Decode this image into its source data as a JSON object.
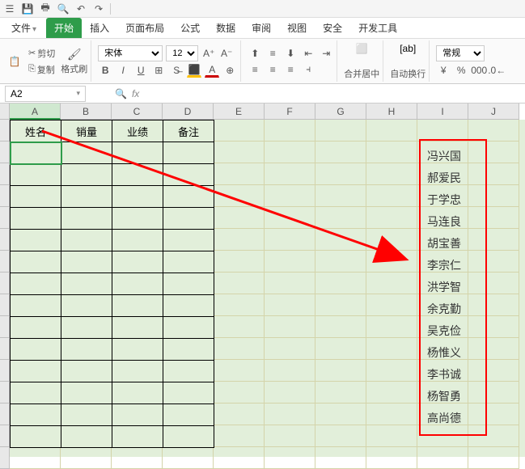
{
  "top_icons": [
    "menu",
    "save",
    "print",
    "preview",
    "undo",
    "redo"
  ],
  "tabs": {
    "file": "文件",
    "items": [
      "开始",
      "插入",
      "页面布局",
      "公式",
      "数据",
      "审阅",
      "视图",
      "安全",
      "开发工具"
    ],
    "active": "开始"
  },
  "clipboard": {
    "cut": "剪切",
    "copy": "复制",
    "format_painter": "格式刷"
  },
  "font": {
    "name": "宋体",
    "size": "12"
  },
  "merge_center": "合并居中",
  "wrap_text": "自动换行",
  "number_format": "常规",
  "name_box": "A2",
  "columns": [
    "A",
    "B",
    "C",
    "D",
    "E",
    "F",
    "G",
    "H",
    "I",
    "J"
  ],
  "table_headers": [
    "姓名",
    "销量",
    "业绩",
    "备注"
  ],
  "names_list": [
    "冯兴国",
    "郝爱民",
    "于学忠",
    "马连良",
    "胡宝善",
    "李宗仁",
    "洪学智",
    "余克勤",
    "吴克俭",
    "杨惟义",
    "李书诚",
    "杨智勇",
    "高尚德"
  ]
}
